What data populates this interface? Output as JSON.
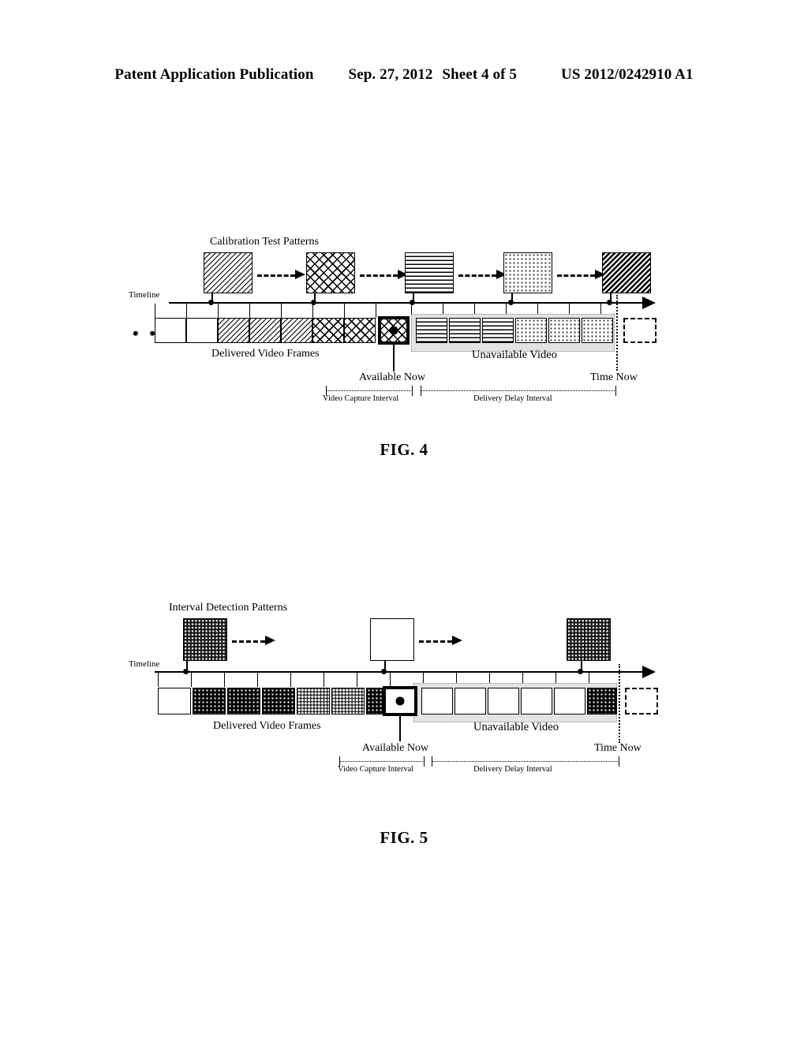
{
  "header": {
    "publication": "Patent Application Publication",
    "date": "Sep. 27, 2012",
    "sheet": "Sheet 4 of 5",
    "patent_number": "US 2012/0242910 A1"
  },
  "figures": [
    {
      "id": "figure-4",
      "caption": "FIG. 4",
      "patterns_title": "Calibration Test Patterns",
      "timeline_label": "Timeline",
      "frames_label": "Delivered Video Frames",
      "unavailable_label": "Unavailable Video",
      "available_now_label": "Available Now",
      "time_now_label": "Time Now",
      "capture_interval_label": "Video Capture Interval",
      "delay_interval_label": "Delivery Delay Interval",
      "ellipsis": "• • •",
      "pattern_boxes": [
        {
          "fill": "diag-fine"
        },
        {
          "fill": "cross"
        },
        {
          "fill": "hlines"
        },
        {
          "fill": "dots-light"
        },
        {
          "fill": "diag-dense"
        }
      ],
      "frames": [
        {
          "fill": "white",
          "state": "delivered"
        },
        {
          "fill": "white",
          "state": "delivered"
        },
        {
          "fill": "diag-fine",
          "state": "delivered"
        },
        {
          "fill": "diag-fine",
          "state": "delivered"
        },
        {
          "fill": "diag-fine",
          "state": "delivered"
        },
        {
          "fill": "cross",
          "state": "delivered"
        },
        {
          "fill": "cross",
          "state": "delivered"
        },
        {
          "fill": "cross",
          "state": "available-now"
        },
        {
          "fill": "hlines",
          "state": "unavailable"
        },
        {
          "fill": "hlines",
          "state": "unavailable"
        },
        {
          "fill": "hlines",
          "state": "unavailable"
        },
        {
          "fill": "dots-light",
          "state": "unavailable"
        },
        {
          "fill": "dots-light",
          "state": "unavailable"
        },
        {
          "fill": "dots-light",
          "state": "unavailable"
        },
        {
          "fill": "white",
          "state": "future"
        }
      ]
    },
    {
      "id": "figure-5",
      "caption": "FIG. 5",
      "patterns_title": "Interval Detection Patterns",
      "timeline_label": "Timeline",
      "frames_label": "Delivered Video Frames",
      "unavailable_label": "Unavailable Video",
      "available_now_label": "Available Now",
      "time_now_label": "Time Now",
      "capture_interval_label": "Video Capture Interval",
      "delay_interval_label": "Delivery Delay Interval",
      "ellipsis": "",
      "pattern_boxes": [
        {
          "fill": "checker-dark"
        },
        {
          "fill": "white"
        },
        {
          "fill": "checker-dark"
        }
      ],
      "frames": [
        {
          "fill": "white",
          "state": "delivered"
        },
        {
          "fill": "dots-dark",
          "state": "delivered"
        },
        {
          "fill": "dots-dark",
          "state": "delivered"
        },
        {
          "fill": "dots-dark",
          "state": "delivered"
        },
        {
          "fill": "checker-mid",
          "state": "delivered"
        },
        {
          "fill": "checker-mid",
          "state": "delivered"
        },
        {
          "fill": "dots-dark",
          "state": "delivered"
        },
        {
          "fill": "white",
          "state": "available-now"
        },
        {
          "fill": "white",
          "state": "unavailable"
        },
        {
          "fill": "white",
          "state": "unavailable"
        },
        {
          "fill": "white",
          "state": "unavailable"
        },
        {
          "fill": "white",
          "state": "unavailable"
        },
        {
          "fill": "white",
          "state": "unavailable"
        },
        {
          "fill": "dots-dark",
          "state": "unavailable"
        },
        {
          "fill": "white",
          "state": "future"
        }
      ]
    }
  ]
}
